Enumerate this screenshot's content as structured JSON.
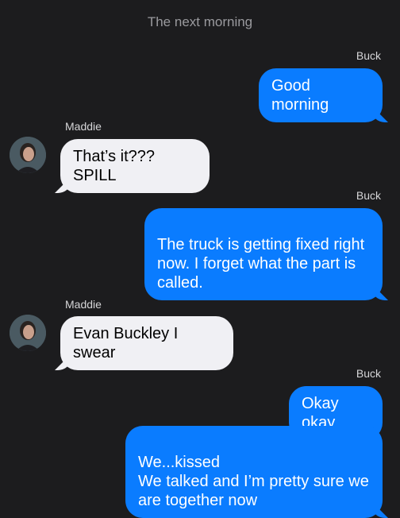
{
  "header": {
    "title": "The next morning"
  },
  "colors": {
    "background": "#1c1c1e",
    "outgoing_bubble": "#0a7cff",
    "incoming_bubble": "#f0f0f4"
  },
  "messages": [
    {
      "sender": "Buck",
      "direction": "outgoing",
      "text": "Good morning"
    },
    {
      "sender": "Maddie",
      "direction": "incoming",
      "text": "That’s it??? SPILL",
      "avatar": "maddie-avatar"
    },
    {
      "sender": "Buck",
      "direction": "outgoing",
      "text": "The truck is getting fixed right now. I forget what the part is called."
    },
    {
      "sender": "Maddie",
      "direction": "incoming",
      "text": "Evan Buckley I swear",
      "avatar": "maddie-avatar"
    },
    {
      "sender": "Buck",
      "direction": "outgoing",
      "text": "Okay okay"
    },
    {
      "sender": "Buck",
      "direction": "outgoing",
      "text": "We...kissed\nWe talked and I’m pretty sure we are together now"
    }
  ]
}
